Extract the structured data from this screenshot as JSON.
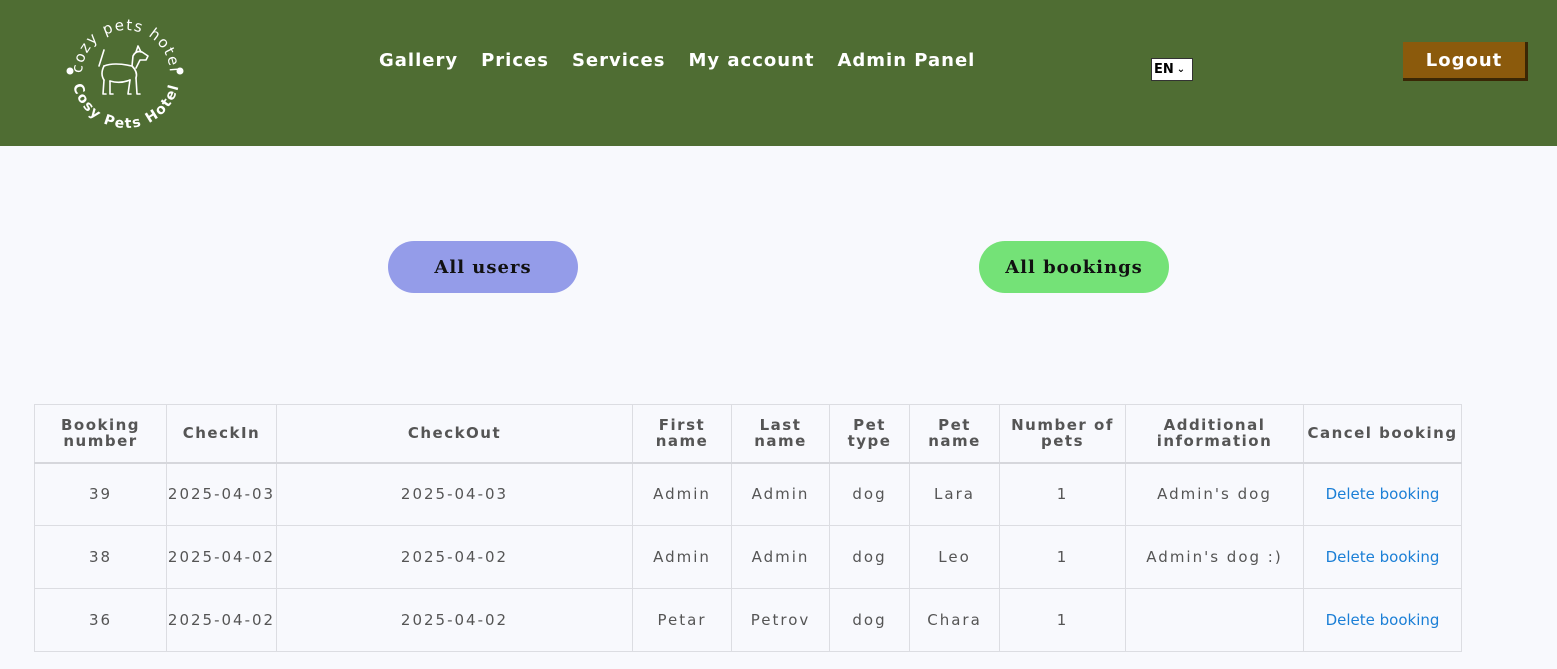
{
  "header": {
    "logo_text_top": "cozy pets hotel",
    "logo_text_bottom": "Cosy Pets Hotel",
    "nav": [
      {
        "label": "Gallery"
      },
      {
        "label": "Prices"
      },
      {
        "label": "Services"
      },
      {
        "label": "My account"
      },
      {
        "label": "Admin Panel"
      }
    ],
    "language": "EN",
    "logout_label": "Logout"
  },
  "colors": {
    "header_bg": "#4f6d33",
    "logout_bg": "#8b5a0c",
    "all_users_bg": "#949ce9",
    "all_bookings_bg": "#74e277",
    "link": "#1b7fd6"
  },
  "admin": {
    "all_users_label": "All users",
    "all_bookings_label": "All bookings"
  },
  "table": {
    "headers": [
      "Booking number",
      "CheckIn",
      "CheckOut",
      "First name",
      "Last name",
      "Pet type",
      "Pet name",
      "Number of pets",
      "Additional information",
      "Cancel booking"
    ],
    "rows": [
      {
        "booking_number": "39",
        "checkin": "2025-04-03",
        "checkout": "2025-04-03",
        "first_name": "Admin",
        "last_name": "Admin",
        "pet_type": "dog",
        "pet_name": "Lara",
        "number_of_pets": "1",
        "additional_info": "Admin's dog",
        "cancel_label": "Delete booking"
      },
      {
        "booking_number": "38",
        "checkin": "2025-04-02",
        "checkout": "2025-04-02",
        "first_name": "Admin",
        "last_name": "Admin",
        "pet_type": "dog",
        "pet_name": "Leo",
        "number_of_pets": "1",
        "additional_info": "Admin's dog :)",
        "cancel_label": "Delete booking"
      },
      {
        "booking_number": "36",
        "checkin": "2025-04-02",
        "checkout": "2025-04-02",
        "first_name": "Petar",
        "last_name": "Petrov",
        "pet_type": "dog",
        "pet_name": "Chara",
        "number_of_pets": "1",
        "additional_info": "",
        "cancel_label": "Delete booking"
      }
    ]
  }
}
